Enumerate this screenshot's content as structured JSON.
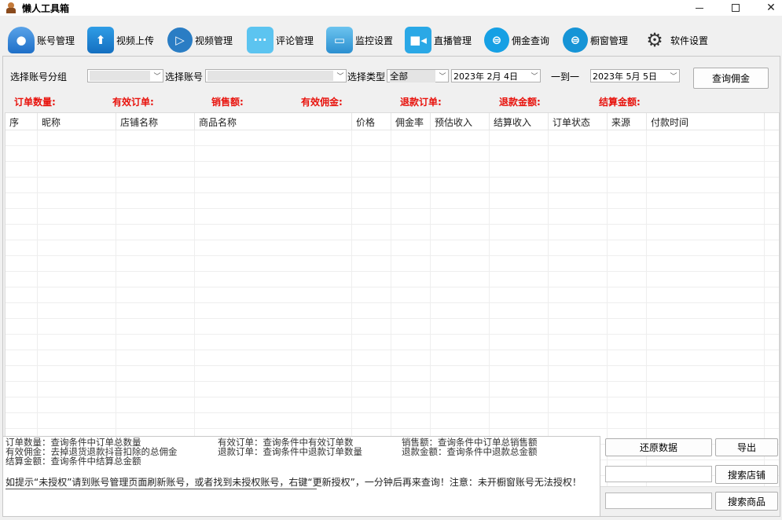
{
  "window": {
    "title": "懒人工具箱"
  },
  "toolbar": [
    {
      "label": "账号管理",
      "icon": "user-accounts-icon",
      "color": "#1e6fc8"
    },
    {
      "label": "视频上传",
      "icon": "upload-icon",
      "color": "#1a8ad8"
    },
    {
      "label": "视频管理",
      "icon": "video-manage-icon",
      "color": "#2a7dc4"
    },
    {
      "label": "评论管理",
      "icon": "chat-bubble-icon",
      "color": "#3db0e8"
    },
    {
      "label": "监控设置",
      "icon": "camera-monitor-icon",
      "color": "#3aa2dc"
    },
    {
      "label": "直播管理",
      "icon": "live-camera-icon",
      "color": "#1ea0e0"
    },
    {
      "label": "佣金查询",
      "icon": "commission-icon",
      "color": "#16a0e4"
    },
    {
      "label": "橱窗管理",
      "icon": "showcase-icon",
      "color": "#1694d6"
    },
    {
      "label": "软件设置",
      "icon": "gears-icon",
      "color": "#333333"
    }
  ],
  "filters": {
    "group_label": "选择账号分组",
    "account_label": "选择账号",
    "type_label": "选择类型",
    "type_value": "全部",
    "date_from": "2023年  2月  4日",
    "range_sep": "一到一",
    "date_to": "2023年  5月  5日",
    "query_button": "查询佣金"
  },
  "stats": {
    "orders": "订单数量:",
    "valid_orders": "有效订单:",
    "sales": "销售额:",
    "valid_commission": "有效佣金:",
    "refund_orders": "退款订单:",
    "refund_amount": "退款金额:",
    "settle_amount": "结算金额:"
  },
  "table": {
    "columns": [
      "序",
      "昵称",
      "店铺名称",
      "商品名称",
      "价格",
      "佣金率",
      "预估收入",
      "结算收入",
      "订单状态",
      "来源",
      "付款时间"
    ]
  },
  "info": {
    "l1a": "订单数量：查询条件中订单总数量",
    "l1b": "有效订单：查询条件中有效订单数",
    "l1c": "销售额：查询条件中订单总销售额",
    "l2a": "有效佣金：去掉退货退款抖音扣除的总佣金",
    "l2b": "退款订单：查询条件中退款订单数量",
    "l2c": "退款金额：查询条件中退款总金额",
    "l3a": "结算金额：查询条件中结算总金额",
    "hint": "如提示“未授权”请到账号管理页面刷新账号，或者找到未授权账号，右键“更新授权”，一分钟后再来查询！注意：未开橱窗账号无法授权！"
  },
  "actions": {
    "restore": "还原数据",
    "export": "导出",
    "search_shop": "搜索店铺",
    "search_product": "搜索商品"
  }
}
